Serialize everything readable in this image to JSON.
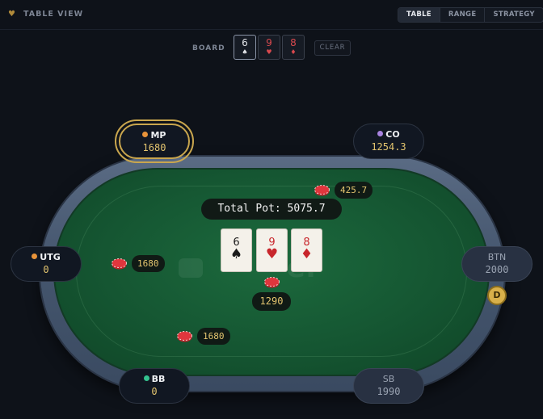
{
  "app": {
    "title": "TABLE VIEW",
    "icon": "heart-icon"
  },
  "view_tabs": [
    {
      "label": "TABLE",
      "active": true
    },
    {
      "label": "RANGE",
      "active": false
    },
    {
      "label": "STRATEGY",
      "active": false
    }
  ],
  "board_picker": {
    "label": "BOARD",
    "cards": [
      {
        "rank": "6",
        "suit": "♠",
        "color": "white"
      },
      {
        "rank": "9",
        "suit": "♥",
        "color": "red"
      },
      {
        "rank": "8",
        "suit": "♦",
        "color": "red"
      }
    ],
    "clear_label": "CLEAR"
  },
  "table": {
    "pot_label": "Total Pot: 5075.7",
    "felt_cards": [
      {
        "rank": "6",
        "suit": "♠",
        "color": "black"
      },
      {
        "rank": "9",
        "suit": "♥",
        "color": "red"
      },
      {
        "rank": "8",
        "suit": "♦",
        "color": "red"
      }
    ],
    "center_bet": "1290",
    "bets": [
      {
        "seat": "CO",
        "amount": "425.7"
      },
      {
        "seat": "UTG",
        "amount": "1680"
      },
      {
        "seat": "BB",
        "amount": "1680"
      }
    ],
    "dealer_button": "D"
  },
  "seats": [
    {
      "name": "MP",
      "stack": "1680",
      "dot_color": "#e8933a",
      "state": "active"
    },
    {
      "name": "CO",
      "stack": "1254.3",
      "dot_color": "#a883e0",
      "state": "in"
    },
    {
      "name": "UTG",
      "stack": "0",
      "dot_color": "#e8933a",
      "state": "in"
    },
    {
      "name": "BTN",
      "stack": "2000",
      "dot_color": "",
      "state": "folded"
    },
    {
      "name": "BB",
      "stack": "0",
      "dot_color": "#34c38f",
      "state": "in"
    },
    {
      "name": "SB",
      "stack": "1990",
      "dot_color": "",
      "state": "folded"
    }
  ],
  "colors": {
    "accent_gold": "#c9a64e",
    "felt_green": "#155632",
    "rail_blue": "#45566e",
    "stack_gold": "#e4c56f"
  }
}
